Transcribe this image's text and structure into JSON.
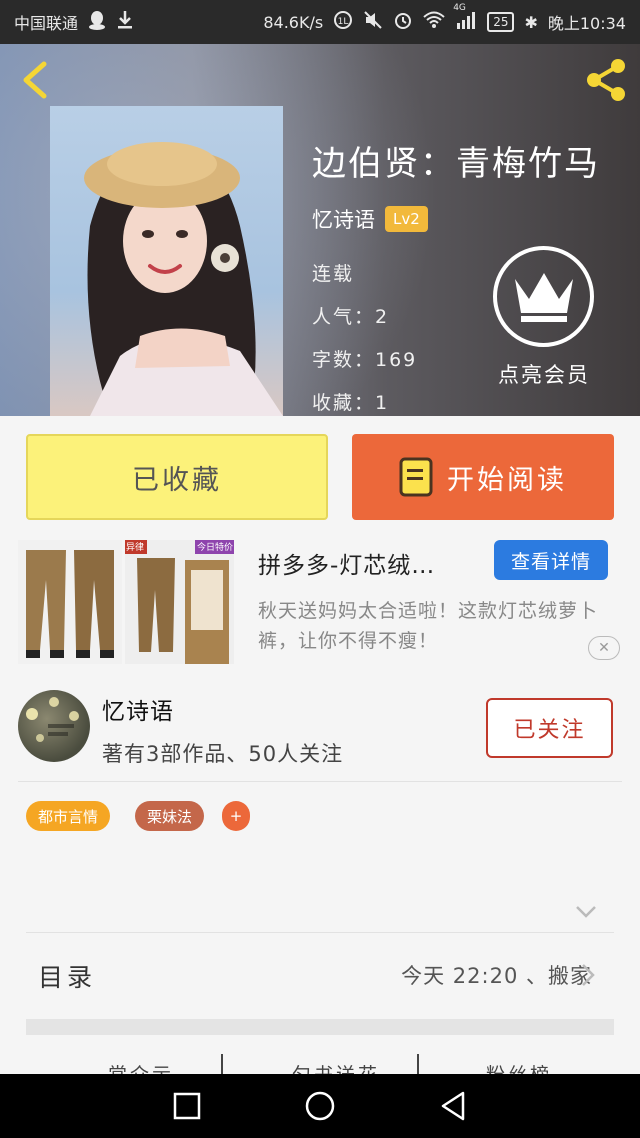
{
  "status_bar": {
    "carrier": "中国联通",
    "net_speed": "84.6K/s",
    "signal_label": "4G",
    "battery": "25",
    "time": "晚上10:34"
  },
  "book": {
    "title": "边伯贤：青梅竹马",
    "author": "忆诗语",
    "level": "Lv2",
    "status": "连载",
    "popularity": "人气：2",
    "word_count": "字数：169",
    "favorites": "收藏：1"
  },
  "vip": {
    "label": "点亮会员"
  },
  "actions": {
    "collected_label": "已收藏",
    "read_label": "开始阅读"
  },
  "ad": {
    "title": "拼多多-灯芯绒…",
    "button_label": "查看详情",
    "description": "秋天送妈妈太合适啦！这款灯芯绒萝卜裤，让你不得不瘦！",
    "badge_left": "异律",
    "badge_right": "今日特价",
    "close_label": "✕"
  },
  "author_card": {
    "name": "忆诗语",
    "stats": "著有3部作品、50人关注",
    "follow_label": "已关注"
  },
  "tags": [
    {
      "label": "都市言情",
      "color": "#f5a623"
    },
    {
      "label": "栗妹法",
      "color": "#c4674a"
    },
    {
      "label": "+",
      "color": "#ec683a"
    }
  ],
  "toc": {
    "label": "目录",
    "latest": "今天 22:20 、搬家"
  },
  "bottom_tabs": [
    "常介示",
    "匀书送花",
    "粉丝榜"
  ],
  "colors": {
    "accent_orange": "#ec683a",
    "collected_yellow": "#fcf27a",
    "badge_gold": "#f2b93b",
    "follow_red": "#c0392b",
    "ad_blue": "#2c7be0"
  }
}
